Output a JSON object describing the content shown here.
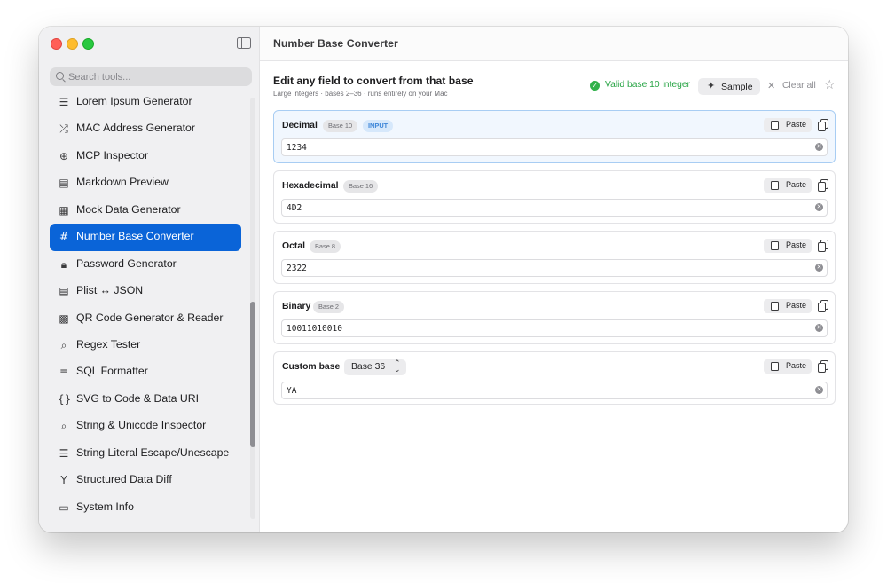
{
  "sidebar": {
    "search_placeholder": "Search tools...",
    "items": [
      {
        "label": "Lorem Ipsum Generator",
        "icon": "text-lines-icon",
        "glyph": "☰",
        "active": false
      },
      {
        "label": "MAC Address Generator",
        "icon": "shuffle-icon",
        "glyph": "⤮",
        "active": false
      },
      {
        "label": "MCP Inspector",
        "icon": "globe-icon",
        "glyph": "⊕",
        "active": false
      },
      {
        "label": "Markdown Preview",
        "icon": "document-icon",
        "glyph": "▤",
        "active": false
      },
      {
        "label": "Mock Data Generator",
        "icon": "table-icon",
        "glyph": "▦",
        "active": false
      },
      {
        "label": "Number Base Converter",
        "icon": "number-sign-icon",
        "glyph": "#",
        "active": true
      },
      {
        "label": "Password Generator",
        "icon": "lock-icon",
        "glyph": "🔒︎",
        "active": false
      },
      {
        "label": "Plist ↔ JSON",
        "icon": "list-box-icon",
        "glyph": "▤",
        "active": false
      },
      {
        "label": "QR Code Generator & Reader",
        "icon": "qr-code-icon",
        "glyph": "▩",
        "active": false
      },
      {
        "label": "Regex Tester",
        "icon": "magnifier-icon",
        "glyph": "⌕",
        "active": false
      },
      {
        "label": "SQL Formatter",
        "icon": "align-left-icon",
        "glyph": "≡",
        "active": false
      },
      {
        "label": "SVG to Code & Data URI",
        "icon": "braces-icon",
        "glyph": "{}",
        "active": false
      },
      {
        "label": "String & Unicode Inspector",
        "icon": "magnifier-icon",
        "glyph": "⌕",
        "active": false
      },
      {
        "label": "String Literal Escape/Unescape",
        "icon": "text-lines-icon",
        "glyph": "☰",
        "active": false
      },
      {
        "label": "Structured Data Diff",
        "icon": "merge-arrow-icon",
        "glyph": "Y",
        "active": false
      },
      {
        "label": "System Info",
        "icon": "monitor-icon",
        "glyph": "▭",
        "active": false
      }
    ]
  },
  "header": {
    "title": "Number Base Converter"
  },
  "main": {
    "heading": "Edit any field to convert from that base",
    "subheading": "Large integers · bases 2–36 · runs entirely on your Mac",
    "status": "Valid base 10 integer",
    "sample_label": "Sample",
    "clear_label": "Clear all"
  },
  "fields": [
    {
      "label": "Decimal",
      "badge": "Base 10",
      "tag": "INPUT",
      "value": "1234",
      "paste": "Paste"
    },
    {
      "label": "Hexadecimal",
      "badge": "Base 16",
      "value": "4D2",
      "paste": "Paste"
    },
    {
      "label": "Octal",
      "badge": "Base 8",
      "value": "2322",
      "paste": "Paste"
    },
    {
      "label": "Binary",
      "badge": "Base 2",
      "value": "10011010010",
      "paste": "Paste"
    },
    {
      "label": "Custom base",
      "select": "Base 36",
      "value": "YA",
      "paste": "Paste"
    }
  ],
  "colors": {
    "accent": "#0a64d8",
    "valid": "#27a444",
    "active_card": "#f1f7fe"
  }
}
